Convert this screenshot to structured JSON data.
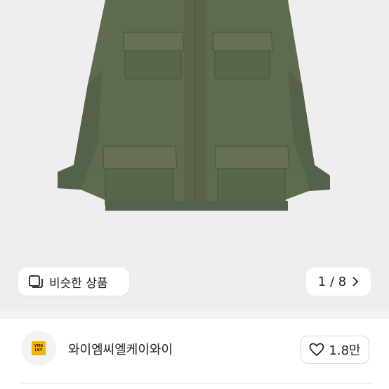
{
  "product_image": {
    "description_icon": "jacket-photo"
  },
  "similar_button": {
    "icon": "similar-items-icon",
    "label": "비슷한 상품"
  },
  "page_indicator": {
    "text": "1 / 8",
    "icon": "chevron-right-icon"
  },
  "seller": {
    "avatar_icon": "seller-logo",
    "logo_text_top": "YMG",
    "logo_text_bottom": "LKY",
    "name": "와이엠씨엘케이와이"
  },
  "like_button": {
    "icon": "heart-icon",
    "count": "1.8만"
  },
  "colors": {
    "background": "#ffffff",
    "image_bg": "#eeeeee",
    "jacket": "#5f6b4e",
    "logo": "#f4b400"
  }
}
